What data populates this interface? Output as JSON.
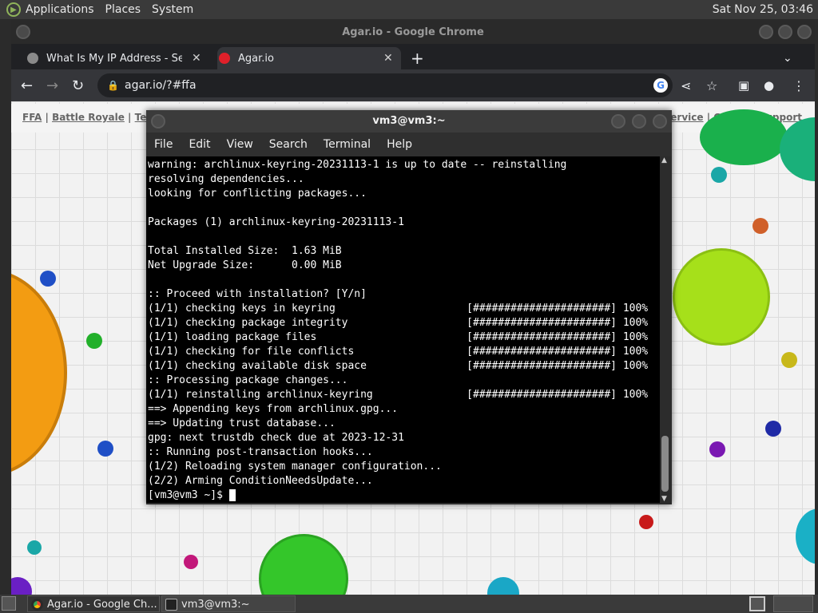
{
  "top_panel": {
    "menus": [
      "Applications",
      "Places",
      "System"
    ],
    "clock": "Sat Nov 25, 03:46"
  },
  "chrome": {
    "window_title": "Agar.io - Google Chrome",
    "tabs": [
      {
        "label": "What Is My IP Address - See Y"
      },
      {
        "label": "Agar.io"
      }
    ],
    "new_tab_symbol": "+",
    "url": "agar.io/?#ffa"
  },
  "agar_page": {
    "nav_left": [
      "FFA",
      "Battle Royale",
      "Team"
    ],
    "nav_right_partial": "of Service",
    "nav_support": "Contact Support"
  },
  "terminal": {
    "title": "vm3@vm3:~",
    "menu": [
      "File",
      "Edit",
      "View",
      "Search",
      "Terminal",
      "Help"
    ],
    "lines": [
      "warning: archlinux-keyring-20231113-1 is up to date -- reinstalling",
      "resolving dependencies...",
      "looking for conflicting packages...",
      "",
      "Packages (1) archlinux-keyring-20231113-1",
      "",
      "Total Installed Size:  1.63 MiB",
      "Net Upgrade Size:      0.00 MiB",
      "",
      ":: Proceed with installation? [Y/n]",
      "(1/1) checking keys in keyring                     [######################] 100%",
      "(1/1) checking package integrity                   [######################] 100%",
      "(1/1) loading package files                        [######################] 100%",
      "(1/1) checking for file conflicts                  [######################] 100%",
      "(1/1) checking available disk space                [######################] 100%",
      ":: Processing package changes...",
      "(1/1) reinstalling archlinux-keyring               [######################] 100%",
      "==> Appending keys from archlinux.gpg...",
      "==> Updating trust database...",
      "gpg: next trustdb check due at 2023-12-31",
      ":: Running post-transaction hooks...",
      "(1/2) Reloading system manager configuration...",
      "(2/2) Arming ConditionNeedsUpdate..."
    ],
    "prompt": "[vm3@vm3 ~]$ "
  },
  "taskbar": {
    "items": [
      {
        "label": "Agar.io - Google Ch..."
      },
      {
        "label": "vm3@vm3:~"
      }
    ]
  }
}
